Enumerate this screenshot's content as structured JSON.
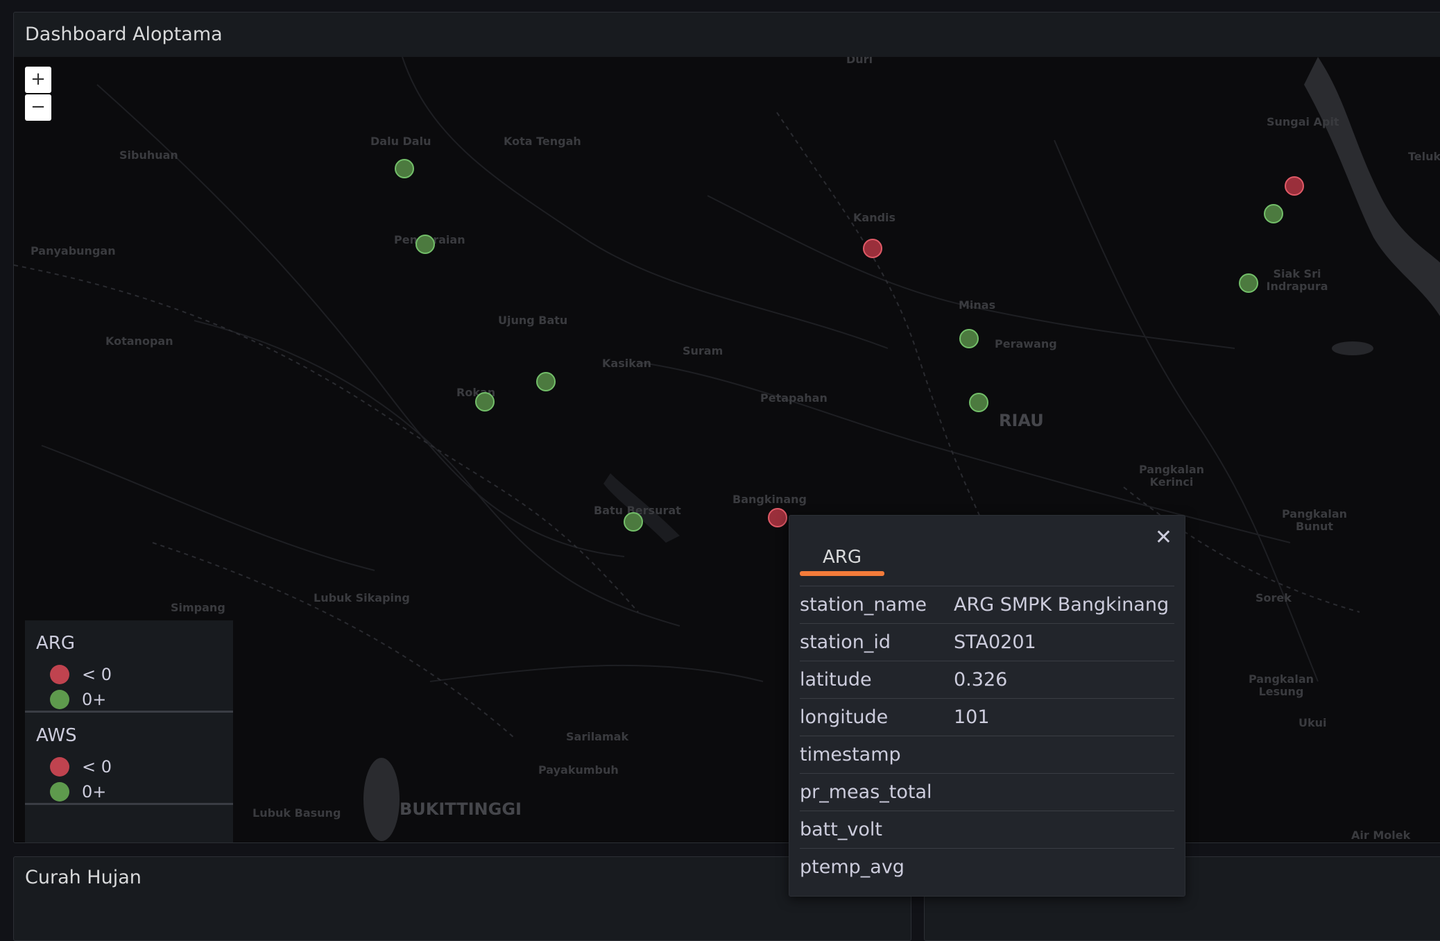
{
  "panels": {
    "map_title": "Dashboard Aloptama",
    "rain_title": "Curah Hujan"
  },
  "map": {
    "zoom_in": "+",
    "zoom_out": "−",
    "places": [
      {
        "name": "Sibuhuan"
      },
      {
        "name": "Dalu Dalu"
      },
      {
        "name": "Kota Tengah"
      },
      {
        "name": "Panyabungan"
      },
      {
        "name": "Pengaraian"
      },
      {
        "name": "Kandis"
      },
      {
        "name": "Kotanopan"
      },
      {
        "name": "Ujung Batu"
      },
      {
        "name": "Minas"
      },
      {
        "name": "Perawang"
      },
      {
        "name": "Suram"
      },
      {
        "name": "Kasikan"
      },
      {
        "name": "Petapahan"
      },
      {
        "name": "Rokan"
      },
      {
        "name": "RIAU"
      },
      {
        "name": "Sungai Apit"
      },
      {
        "name": "Teluk"
      },
      {
        "name": "Siak Sri Indrapura"
      },
      {
        "name": "Pangkalan Kerinci"
      },
      {
        "name": "Batu Bersurat"
      },
      {
        "name": "Bangkinang"
      },
      {
        "name": "Pangkalan Bunut"
      },
      {
        "name": "Lubuk Sikaping"
      },
      {
        "name": "Simpang"
      },
      {
        "name": "Sorek"
      },
      {
        "name": "Pangkalan Lesung"
      },
      {
        "name": "Ukui"
      },
      {
        "name": "Sarilamak"
      },
      {
        "name": "Payakumbuh"
      },
      {
        "name": "Lubuk Basung"
      },
      {
        "name": "BUKITTINGGI"
      },
      {
        "name": "Air Molek"
      },
      {
        "name": "Duri"
      }
    ]
  },
  "legend": {
    "groups": [
      {
        "title": "ARG",
        "items": [
          {
            "label": "< 0",
            "color": "#c0434f"
          },
          {
            "label": "0+",
            "color": "#5e9a4d"
          }
        ]
      },
      {
        "title": "AWS",
        "items": [
          {
            "label": "< 0",
            "color": "#c0434f"
          },
          {
            "label": "0+",
            "color": "#5e9a4d"
          }
        ]
      }
    ]
  },
  "popup": {
    "tab": "ARG",
    "close_icon": "close-icon",
    "rows": [
      {
        "key": "station_name",
        "value": "ARG SMPK Bangkinang"
      },
      {
        "key": "station_id",
        "value": "STA0201"
      },
      {
        "key": "latitude",
        "value": "0.326"
      },
      {
        "key": "longitude",
        "value": "101"
      },
      {
        "key": "timestamp",
        "value": ""
      },
      {
        "key": "pr_meas_total",
        "value": ""
      },
      {
        "key": "batt_volt",
        "value": ""
      },
      {
        "key": "ptemp_avg",
        "value": ""
      }
    ]
  },
  "colors": {
    "accent": "#f47b3a",
    "positive": "#73bf69",
    "negative": "#e05a67",
    "panel_bg": "#181b1f"
  }
}
